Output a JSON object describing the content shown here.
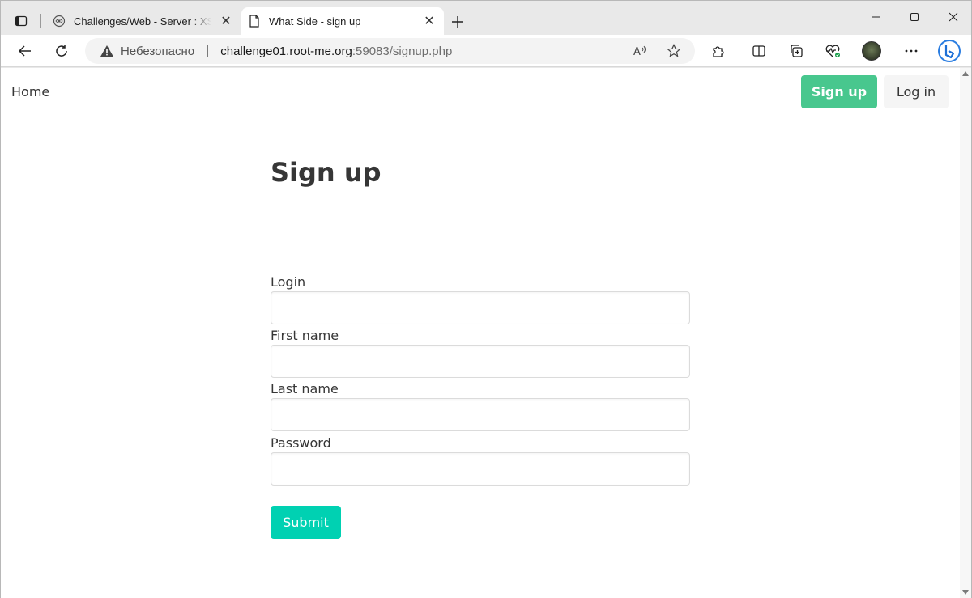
{
  "browser": {
    "tabs": [
      {
        "title": "Challenges/Web - Server : XSS - Stored - filter bypass",
        "favicon": "root-me-icon",
        "active": false
      },
      {
        "title": "What Side - sign up",
        "favicon": "page-icon",
        "active": true
      }
    ],
    "address": {
      "security_label": "Небезопасно",
      "host": "challenge01.root-me.org",
      "path": ":59083/signup.php"
    }
  },
  "page": {
    "nav": {
      "home": "Home",
      "signup": "Sign up",
      "login": "Log in"
    },
    "title": "Sign up",
    "form": {
      "fields": [
        {
          "label": "Login",
          "value": ""
        },
        {
          "label": "First name",
          "value": ""
        },
        {
          "label": "Last name",
          "value": ""
        },
        {
          "label": "Password",
          "value": ""
        }
      ],
      "submit": "Submit"
    },
    "colors": {
      "primary_success": "#48c78e",
      "primary": "#00d1b2",
      "text": "#363636"
    }
  }
}
